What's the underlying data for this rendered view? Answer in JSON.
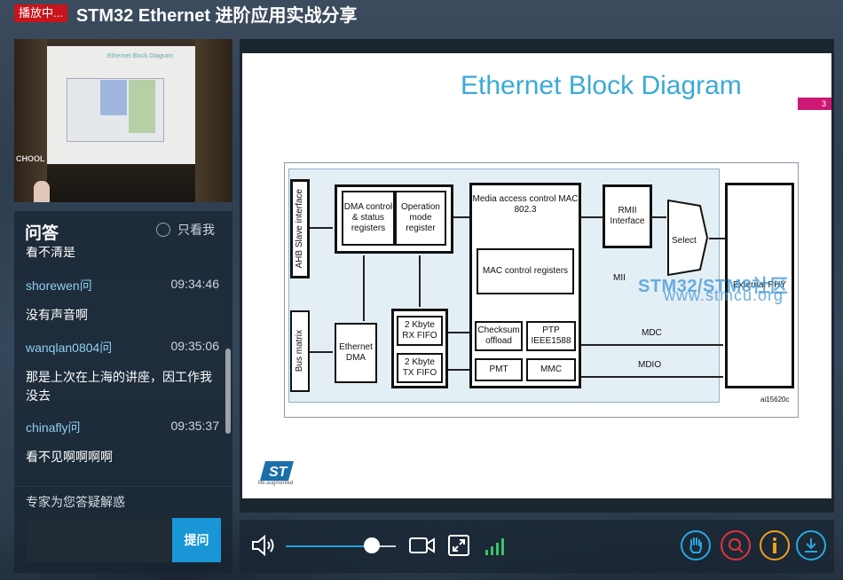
{
  "header": {
    "live_badge": "播放中...",
    "title": "STM32 Ethernet 进阶应用实战分享"
  },
  "camera": {
    "screen_title": "Ethernet Block Diagram",
    "sign": "CHOOL"
  },
  "qa": {
    "title": "问答",
    "only_mine_label": "只看我",
    "cut_text": "看不清是",
    "items": [
      {
        "user": "shorewen问",
        "time": "09:34:46",
        "message": "没有声音啊"
      },
      {
        "user": "wanqlan0804问",
        "time": "09:35:06",
        "message": "那是上次在上海的讲座，因工作我没去"
      },
      {
        "user": "chinafly问",
        "time": "09:35:37",
        "message": "看不见啊啊啊啊"
      }
    ],
    "hint": "专家为您答疑解惑",
    "input_value": "",
    "submit_label": "提问"
  },
  "slide": {
    "title": "Ethernet Block Diagram",
    "page_number": "3",
    "diagram": {
      "ahb_slave": "AHB Slave interface",
      "bus_matrix": "Bus matrix",
      "dma_regs": "DMA control & status registers",
      "op_mode": "Operation mode register",
      "eth_dma": "Ethernet DMA",
      "rx_fifo": "2 Kbyte RX FIFO",
      "tx_fifo": "2 Kbyte TX FIFO",
      "mac_ctrl": "Media access control MAC 802.3",
      "mac_regs": "MAC control registers",
      "checksum": "Checksum offload",
      "ptp": "PTP IEEE1588",
      "pmt": "PMT",
      "mmc": "MMC",
      "rmii": "RMII Interface",
      "mii": "MII",
      "select": "Select",
      "ext_phy": "External PHY",
      "mdc": "MDC",
      "mdio": "MDIO",
      "ref": "ai15620c"
    },
    "watermark": "STM32/STM8社区",
    "watermark_url": "www.stmcu.org",
    "logo_tagline": "life.augmented"
  },
  "controls": {
    "volume_percent": 78,
    "accent": "#1fa2e0",
    "icons": [
      "speaker-icon",
      "camera-icon",
      "fullscreen-exit-icon",
      "signal-icon",
      "hand-icon",
      "question-icon",
      "info-icon",
      "download-icon"
    ],
    "colors": {
      "hand": "#29a8e0",
      "question": "#e0353b",
      "info": "#f0a21c",
      "download": "#29a8e0"
    }
  }
}
